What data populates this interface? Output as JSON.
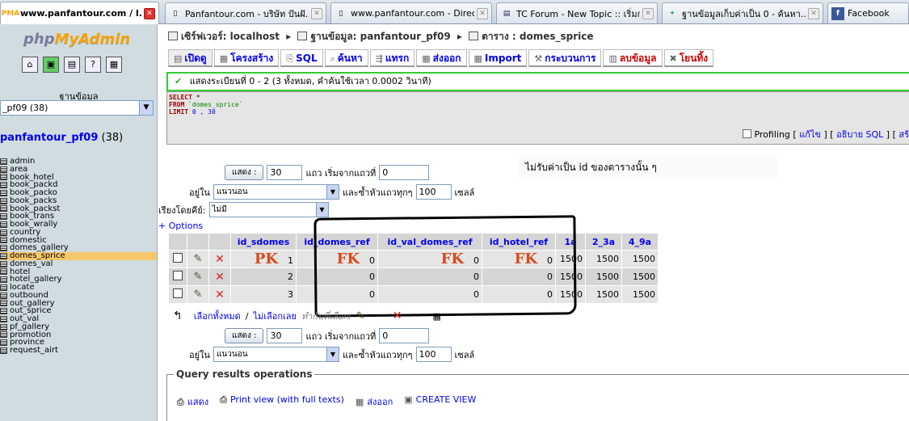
{
  "browser_tabs": [
    {
      "title": "www.panfantour.com / l...",
      "icon": "phpmyadmin-icon",
      "active": true
    },
    {
      "title": "Panfantour.com - บริษัท ปันฝั...",
      "icon": "page-icon",
      "active": false
    },
    {
      "title": "www.panfantour.com - Direct...",
      "icon": "page-icon",
      "active": false
    },
    {
      "title": "TC Forum - New Topic :: เริ่มก...",
      "icon": "forum-icon",
      "active": false
    },
    {
      "title": "ฐานข้อมูลเก็บค่าเป็น 0 - ค้นหา...",
      "icon": "google-icon",
      "active": false
    },
    {
      "title": "Facebook",
      "icon": "facebook-icon",
      "active": false
    }
  ],
  "left": {
    "logo_part1": "php",
    "logo_part2": "MyAdmin",
    "db_label": "ฐานข้อมูล",
    "db_select_value": "_pf09 (38)",
    "db_title": "panfantour_pf09",
    "db_count": "(38)",
    "tables": [
      "admin",
      "area",
      "book_hotel",
      "book_packd",
      "book_packo",
      "book_packs",
      "book_packst",
      "book_trans",
      "book_wrally",
      "country",
      "domestic",
      "domes_gallery",
      "domes_sprice",
      "domes_val",
      "hotel",
      "hotel_gallery",
      "locate",
      "outbound",
      "out_gallery",
      "out_sprice",
      "out_val",
      "pf_gallery",
      "promotion",
      "province",
      "request_airt"
    ],
    "active_table": "domes_sprice"
  },
  "breadcrumb": {
    "server_label": "เซิร์ฟเวอร์:",
    "server": "localhost",
    "db_label": "ฐานข้อมูล:",
    "db": "panfantour_pf09",
    "table_label": "ตาราง :",
    "table": "domes_sprice"
  },
  "tabs": [
    {
      "label": "เปิดดู",
      "icon": "browse-icon",
      "active": true
    },
    {
      "label": "โครงสร้าง",
      "icon": "structure-icon"
    },
    {
      "label": "SQL",
      "icon": "sql-icon"
    },
    {
      "label": "ค้นหา",
      "icon": "search-icon"
    },
    {
      "label": "แทรก",
      "icon": "insert-icon"
    },
    {
      "label": "ส่งออก",
      "icon": "export-icon"
    },
    {
      "label": "Import",
      "icon": "import-icon"
    },
    {
      "label": "กระบวนการ",
      "icon": "operations-icon"
    },
    {
      "label": "ลบข้อมูล",
      "icon": "empty-icon",
      "red": true
    },
    {
      "label": "โยนทิ้ง",
      "icon": "drop-icon",
      "red": true
    }
  ],
  "success_message": "แสดงระเบียนที่ 0 - 2 (3 ทั้งหมด, คำค้นใช้เวลา 0.0002 วินาที)",
  "sql": {
    "kw1": "SELECT",
    "star": " *",
    "kw2": "FROM",
    "table": " `domes_sprice`",
    "kw3": "LIMIT",
    "limit": " 0 , 30"
  },
  "profiling": {
    "label": "Profiling",
    "edit": "แก้ไข",
    "explain": "อธิบาย SQL",
    "extra": "สร้"
  },
  "nav": {
    "show_button": "แสดง :",
    "rows_value": "30",
    "rows_label": "แถว เริ่มจากแถวที่",
    "start_value": "0",
    "mode_prefix": "อยู่ใน",
    "mode_value": "แนวนอน",
    "repeat_label": "และซ้ำหัวแถวทุกๆ",
    "repeat_value": "100",
    "cells_label": "เซลล์",
    "sort_label": "เรียงโดยคีย์:",
    "sort_value": "ไม่มี"
  },
  "note": "ไม่รับค่าเป็น id ของตารางนั้น ๆ",
  "options_link": "+ Options",
  "table": {
    "columns": [
      "id_sdomes",
      "id_domes_ref",
      "id_val_domes_ref",
      "id_hotel_ref",
      "1a",
      "2_3a",
      "4_9a"
    ],
    "rows": [
      [
        "1",
        "0",
        "0",
        "0",
        "1500",
        "1500",
        "1500"
      ],
      [
        "2",
        "0",
        "0",
        "0",
        "1500",
        "1500",
        "1500"
      ],
      [
        "3",
        "0",
        "0",
        "0",
        "1500",
        "1500",
        "1500"
      ]
    ],
    "pk_label": "PK",
    "fk_label": "FK"
  },
  "select_row": {
    "check_all": "เลือกทั้งหมด",
    "sep": " / ",
    "uncheck_all": "ไม่เลือกเลย",
    "with_selected": "ทำกับที่เลือก:"
  },
  "query_ops": {
    "legend": "Query results operations",
    "links": [
      "แสดง",
      "Print view (with full texts)",
      "ส่งออก",
      "CREATE VIEW"
    ]
  },
  "colors": {
    "pk_fk": "#d64a1a",
    "link": "#0000ee",
    "success_border": "#33cc33",
    "active_table": "#f7c76b"
  }
}
